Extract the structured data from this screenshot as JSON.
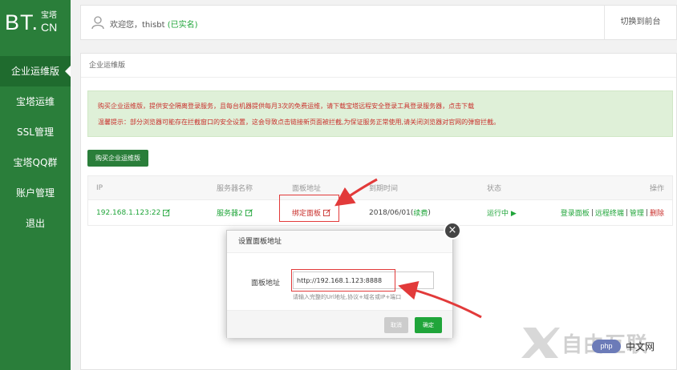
{
  "logo": {
    "main": "BT.",
    "cn_top": "宝塔",
    "cn_bottom": "CN"
  },
  "sidebar": {
    "items": [
      {
        "label": "企业运维版",
        "active": true
      },
      {
        "label": "宝塔运维"
      },
      {
        "label": "SSL管理"
      },
      {
        "label": "宝塔QQ群"
      },
      {
        "label": "账户管理"
      },
      {
        "label": "退出"
      }
    ]
  },
  "topbar": {
    "welcome": "欢迎您，thisbt",
    "auth_status": "(已实名)",
    "switch_label": "切换到前台"
  },
  "content": {
    "breadcrumb": "企业运维版",
    "notice_line1": "购买企业运维版，提供安全隔离登录服务，且每台机器提供每月3次的免费运维，请下载宝塔远程安全登录工具登录服务器，点击下载",
    "notice_line2": "温馨提示：部分浏览器可能存在拦截窗口的安全设置，这会导致点击链接新页面被拦截,为保证服务正常使用,请关闭浏览器对官网的弹窗拦截。",
    "buy_button": "购买企业运维版"
  },
  "table": {
    "headers": {
      "ip": "IP",
      "name": "服务器名称",
      "panel": "面板地址",
      "expire": "到期时间",
      "status": "状态",
      "ops": "操作"
    },
    "rows": [
      {
        "ip": "192.168.1.123:22",
        "name": "服务器2",
        "panel": "绑定面板",
        "expire": "2018/06/01(",
        "renew": "续费",
        "expire_close": ")",
        "status": "运行中 ▶",
        "ops": {
          "login": "登录面板",
          "remote": "远程终端",
          "manage": "管理",
          "delete": "删除"
        }
      }
    ]
  },
  "modal": {
    "title": "设置面板地址",
    "label": "面板地址",
    "value": "http://192.168.1.123:8888",
    "hint": "请输入完整的Url地址,协议+域名或IP+端口",
    "cancel": "取消",
    "ok": "确定",
    "close": "×"
  },
  "watermark": {
    "text": "自由互联",
    "php": "php",
    "site": "中文网"
  },
  "colors": {
    "sidebar": "#2a7e3a",
    "accent": "#20a53a",
    "danger": "#c9302c",
    "highlight": "#e23a3a"
  }
}
